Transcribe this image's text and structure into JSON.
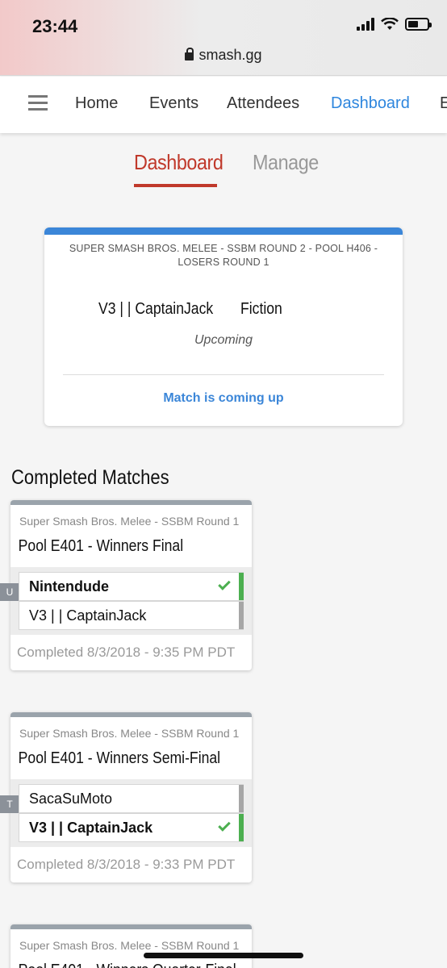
{
  "status_bar": {
    "time": "23:44",
    "url": "smash.gg"
  },
  "nav": {
    "items": [
      "Home",
      "Events",
      "Attendees",
      "Dashboard",
      "E"
    ]
  },
  "tabs": {
    "dashboard": "Dashboard",
    "manage": "Manage"
  },
  "upcoming": {
    "title": "SUPER SMASH BROS. MELEE - SSBM ROUND 2 - POOL H406 - LOSERS ROUND 1",
    "player1": "V3 | | CaptainJack",
    "player2": "Fiction",
    "status": "Upcoming",
    "link": "Match is coming up"
  },
  "completed_title": "Completed Matches",
  "matches": [
    {
      "event": "Super Smash Bros. Melee - SSBM Round 1",
      "round": "Pool E401 - Winners Final",
      "tag": "U",
      "players": [
        {
          "name": "Nintendude",
          "winner": true
        },
        {
          "name": "V3 | | CaptainJack",
          "winner": false
        }
      ],
      "completed": "Completed 8/3/2018 - 9:35 PM PDT"
    },
    {
      "event": "Super Smash Bros. Melee - SSBM Round 1",
      "round": "Pool E401 - Winners Semi-Final",
      "tag": "T",
      "players": [
        {
          "name": "SacaSuMoto",
          "winner": false
        },
        {
          "name": "V3 | | CaptainJack",
          "winner": true
        }
      ],
      "completed": "Completed 8/3/2018 - 9:33 PM PDT"
    },
    {
      "event": "Super Smash Bros. Melee - SSBM Round 1",
      "round": "Pool E401 - Winners Quarter-Final"
    }
  ],
  "colors": {
    "accent_blue": "#3b86d8",
    "accent_red": "#c0392b",
    "win_green": "#4caf50"
  }
}
